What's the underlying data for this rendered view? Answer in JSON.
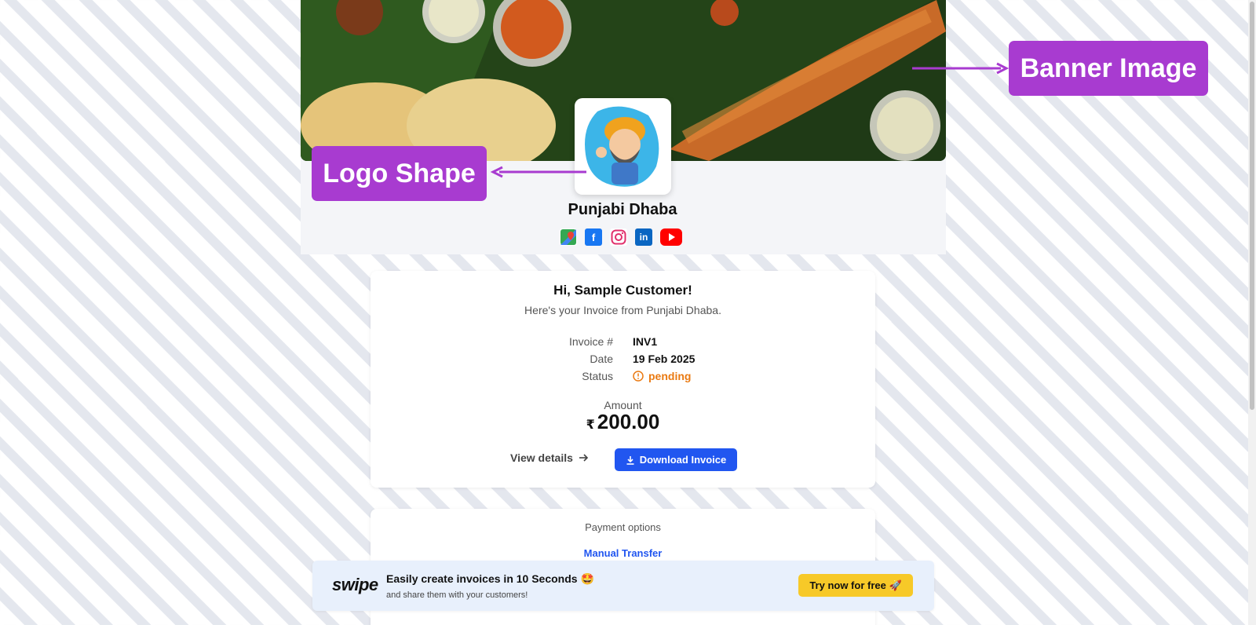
{
  "header": {
    "brand_name": "Punjabi Dhaba",
    "social": [
      "google-maps-icon",
      "facebook-icon",
      "instagram-icon",
      "linkedin-icon",
      "youtube-icon"
    ]
  },
  "annotations": {
    "banner": "Banner Image",
    "logo": "Logo Shape"
  },
  "invoice": {
    "greeting": "Hi, Sample Customer!",
    "subtitle": "Here's your Invoice from Punjabi Dhaba.",
    "fields": [
      {
        "label": "Invoice #",
        "value": "INV1"
      },
      {
        "label": "Date",
        "value": "19 Feb 2025"
      },
      {
        "label": "Status",
        "value": "pending"
      }
    ],
    "amount_label": "Amount",
    "currency": "₹",
    "amount": "200.00",
    "view_details": "View details",
    "download": "Download Invoice"
  },
  "payment": {
    "title": "Payment options",
    "method": "Manual Transfer"
  },
  "promo": {
    "logo_text": "swipe",
    "title": "Easily create invoices in 10 Seconds 🤩",
    "subtitle": "and share them with your customers!",
    "cta": "Try now for free 🚀"
  },
  "colors": {
    "accent": "#2156f0",
    "annotation": "#a83bd0",
    "status_pending": "#ea7a12",
    "cta": "#f7c928"
  }
}
